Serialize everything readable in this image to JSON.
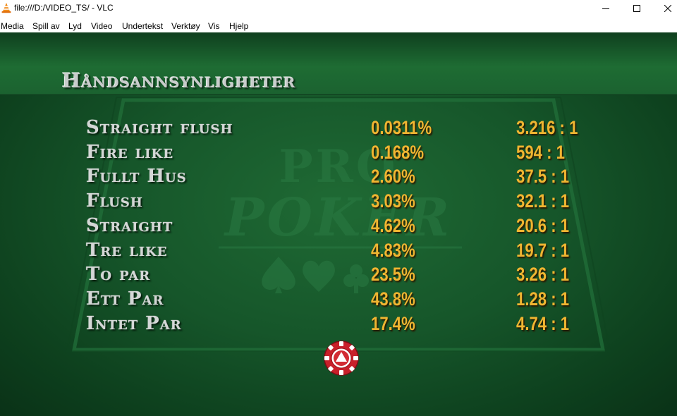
{
  "window": {
    "title": "file:///D:/VIDEO_TS/ - VLC",
    "app_icon": "vlc-cone-icon",
    "controls": [
      "minimize-icon",
      "maximize-icon",
      "close-icon"
    ]
  },
  "menu": [
    {
      "label": "Media"
    },
    {
      "label": "Spill av"
    },
    {
      "label": "Lyd"
    },
    {
      "label": "Video"
    },
    {
      "label": "Undertekst"
    },
    {
      "label": "Verktøy"
    },
    {
      "label": "Vis"
    },
    {
      "label": "Hjelp"
    }
  ],
  "video": {
    "heading": "Håndsannsynligheter",
    "watermark": "PRO POKER",
    "rows": [
      {
        "hand": "Straight flush",
        "probability": "0.0311%",
        "odds": "3.216 : 1"
      },
      {
        "hand": "Fire like",
        "probability": "0.168%",
        "odds": "594 : 1"
      },
      {
        "hand": "Fullt Hus",
        "probability": "2.60%",
        "odds": "37.5 : 1"
      },
      {
        "hand": "Flush",
        "probability": "3.03%",
        "odds": "32.1 : 1"
      },
      {
        "hand": "Straight",
        "probability": "4.62%",
        "odds": "20.6 : 1"
      },
      {
        "hand": "Tre like",
        "probability": "4.83%",
        "odds": "19.7 : 1"
      },
      {
        "hand": "To par",
        "probability": "23.5%",
        "odds": "3.26 : 1"
      },
      {
        "hand": "Ett Par",
        "probability": "43.8%",
        "odds": "1.28 : 1"
      },
      {
        "hand": "Intet Par",
        "probability": "17.4%",
        "odds": "4.74 : 1"
      }
    ],
    "menu_button_icon": "poker-chip-up-arrow-icon"
  },
  "colors": {
    "felt": "#16562a",
    "value_gold": "#f0b531",
    "label_silver": "#d4d7d6",
    "chip_red": "#c8202a"
  }
}
